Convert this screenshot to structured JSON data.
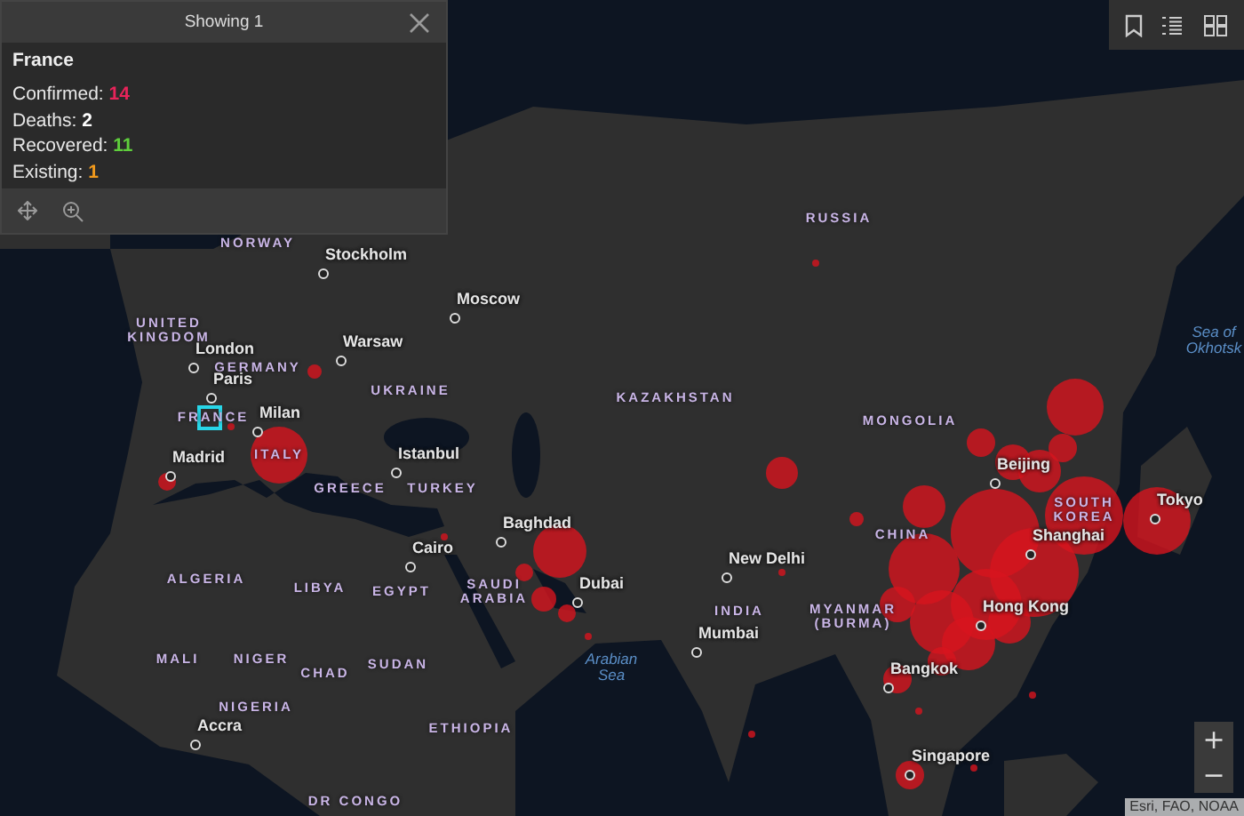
{
  "popup": {
    "header": "Showing 1",
    "title": "France",
    "fields": [
      {
        "label": "Confirmed:",
        "value": "14",
        "kind": "confirmed"
      },
      {
        "label": "Deaths:",
        "value": "2",
        "kind": "deaths"
      },
      {
        "label": "Recovered:",
        "value": "11",
        "kind": "recovered"
      },
      {
        "label": "Existing:",
        "value": "1",
        "kind": "existing"
      }
    ]
  },
  "map_labels": [
    {
      "text": "RUSSIA",
      "kind": "country"
    },
    {
      "text": "NORWAY",
      "kind": "country"
    },
    {
      "text": "Stockholm",
      "kind": "city"
    },
    {
      "text": "Moscow",
      "kind": "city"
    },
    {
      "text": "UNITED KINGDOM",
      "kind": "country"
    },
    {
      "text": "London",
      "kind": "city"
    },
    {
      "text": "Warsaw",
      "kind": "city"
    },
    {
      "text": "GERMANY",
      "kind": "country"
    },
    {
      "text": "Paris",
      "kind": "city"
    },
    {
      "text": "UKRAINE",
      "kind": "country"
    },
    {
      "text": "KAZAKHSTAN",
      "kind": "country"
    },
    {
      "text": "FRANCE",
      "kind": "country"
    },
    {
      "text": "Milan",
      "kind": "city"
    },
    {
      "text": "MONGOLIA",
      "kind": "country"
    },
    {
      "text": "Madrid",
      "kind": "city"
    },
    {
      "text": "ITALY",
      "kind": "country"
    },
    {
      "text": "Istanbul",
      "kind": "city"
    },
    {
      "text": "Beijing",
      "kind": "city"
    },
    {
      "text": "GREECE",
      "kind": "country"
    },
    {
      "text": "TURKEY",
      "kind": "country"
    },
    {
      "text": "SOUTH KOREA",
      "kind": "country"
    },
    {
      "text": "Tokyo",
      "kind": "city"
    },
    {
      "text": "Baghdad",
      "kind": "city"
    },
    {
      "text": "CHINA",
      "kind": "country"
    },
    {
      "text": "Shanghai",
      "kind": "city"
    },
    {
      "text": "Cairo",
      "kind": "city"
    },
    {
      "text": "New Delhi",
      "kind": "city"
    },
    {
      "text": "ALGERIA",
      "kind": "country"
    },
    {
      "text": "LIBYA",
      "kind": "country"
    },
    {
      "text": "EGYPT",
      "kind": "country"
    },
    {
      "text": "SAUDI ARABIA",
      "kind": "country"
    },
    {
      "text": "Dubai",
      "kind": "city"
    },
    {
      "text": "INDIA",
      "kind": "country"
    },
    {
      "text": "MYANMAR (BURMA)",
      "kind": "country"
    },
    {
      "text": "Hong Kong",
      "kind": "city"
    },
    {
      "text": "Mumbai",
      "kind": "city"
    },
    {
      "text": "MALI",
      "kind": "country"
    },
    {
      "text": "NIGER",
      "kind": "country"
    },
    {
      "text": "SUDAN",
      "kind": "country"
    },
    {
      "text": "CHAD",
      "kind": "country"
    },
    {
      "text": "Arabian Sea",
      "kind": "sea"
    },
    {
      "text": "Bangkok",
      "kind": "city"
    },
    {
      "text": "NIGERIA",
      "kind": "country"
    },
    {
      "text": "ETHIOPIA",
      "kind": "country"
    },
    {
      "text": "Accra",
      "kind": "city"
    },
    {
      "text": "Singapore",
      "kind": "city"
    },
    {
      "text": "DR CONGO",
      "kind": "country"
    },
    {
      "text": "Sea of Okhotsk",
      "kind": "sea"
    }
  ],
  "zoom": {
    "in": "+",
    "out": "−"
  },
  "attribution": "Esri, FAO, NOAA"
}
